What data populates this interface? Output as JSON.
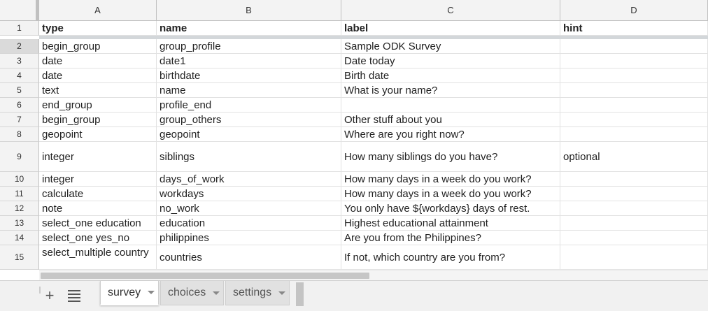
{
  "columns": [
    "A",
    "B",
    "C",
    "D"
  ],
  "header_row": {
    "num": "1",
    "cells": [
      "type",
      "name",
      "label",
      "hint"
    ]
  },
  "rows": [
    {
      "num": "2",
      "cells": [
        "begin_group",
        "group_profile",
        "Sample ODK Survey",
        ""
      ]
    },
    {
      "num": "3",
      "cells": [
        "date",
        "date1",
        "Date today",
        ""
      ]
    },
    {
      "num": "4",
      "cells": [
        "date",
        "birthdate",
        "Birth date",
        ""
      ]
    },
    {
      "num": "5",
      "cells": [
        "text",
        "name",
        "What is your name?",
        ""
      ]
    },
    {
      "num": "6",
      "cells": [
        "end_group",
        "profile_end",
        "",
        ""
      ]
    },
    {
      "num": "7",
      "cells": [
        "begin_group",
        "group_others",
        "Other stuff about you",
        ""
      ]
    },
    {
      "num": "8",
      "cells": [
        "geopoint",
        "geopoint",
        "Where are you right now?",
        ""
      ]
    },
    {
      "num": "9",
      "cells": [
        "integer",
        "siblings",
        "How many siblings do you have?",
        "optional"
      ]
    },
    {
      "num": "10",
      "cells": [
        "integer",
        "days_of_work",
        "How many days in a week do you work?",
        ""
      ]
    },
    {
      "num": "11",
      "cells": [
        "calculate",
        "workdays",
        "How many days in a week do you work?",
        ""
      ]
    },
    {
      "num": "12",
      "cells": [
        "note",
        "no_work",
        "You only have ${workdays} days of rest.",
        ""
      ]
    },
    {
      "num": "13",
      "cells": [
        "select_one education",
        "education",
        "Highest educational attainment",
        ""
      ]
    },
    {
      "num": "14",
      "cells": [
        "select_one yes_no",
        "philippines",
        "Are you from the Philippines?",
        ""
      ]
    },
    {
      "num": "15",
      "cells": [
        "select_multiple country",
        "countries",
        "If not, which country are you from?",
        ""
      ]
    }
  ],
  "tabs": [
    {
      "label": "survey",
      "active": true
    },
    {
      "label": "choices",
      "active": false
    },
    {
      "label": "settings",
      "active": false
    }
  ],
  "icons": {
    "add": "plus-icon",
    "list": "list-icon",
    "dropdown": "caret-down-icon"
  },
  "colors": {
    "header_bg": "#f3f3f3",
    "freeze_bar": "#d3d7da",
    "tabbar_bg": "#f1f1f1"
  }
}
